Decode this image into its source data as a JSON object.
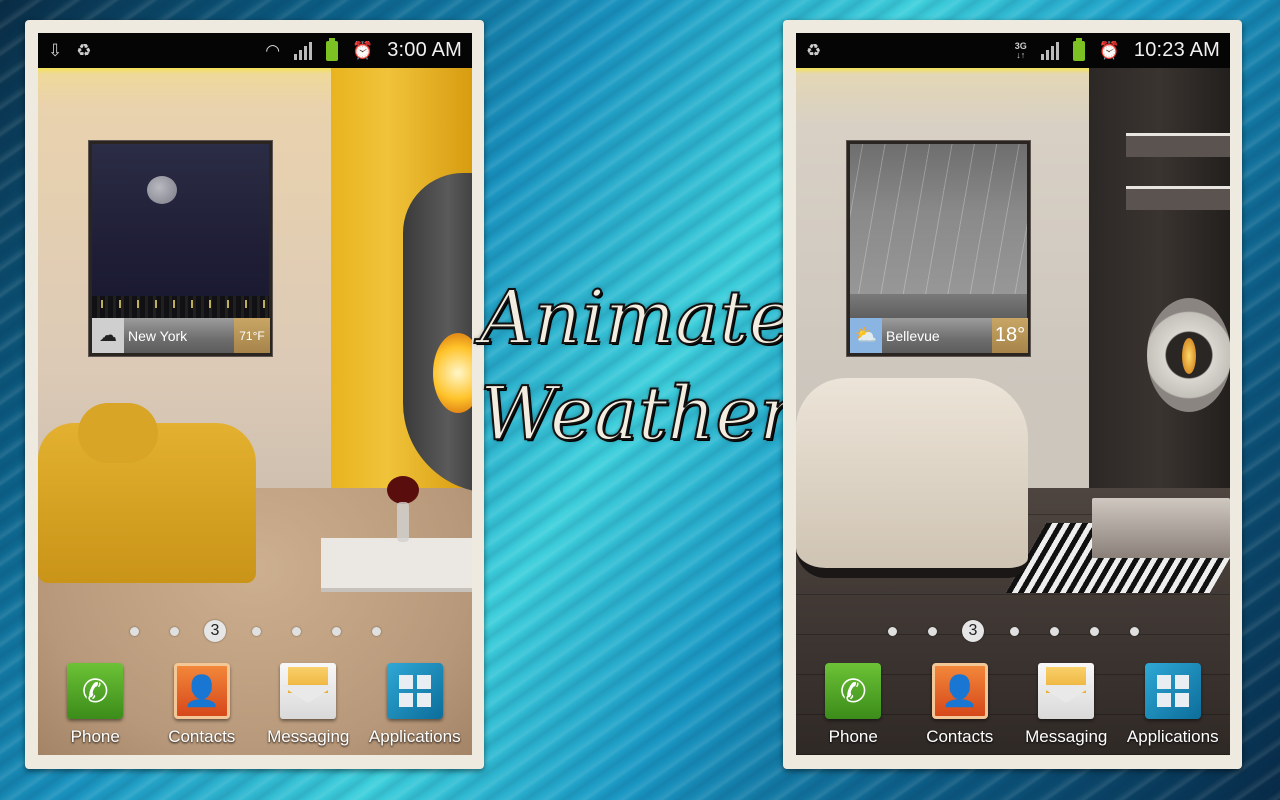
{
  "title": {
    "line1": "Animated",
    "line2": "Weather"
  },
  "screens": [
    {
      "status": {
        "left_icons": [
          "download-icon",
          "recycle-icon"
        ],
        "right_icons": [
          "wifi-icon",
          "signal-icon",
          "battery-icon",
          "alarm-icon"
        ],
        "time": "3:00 AM"
      },
      "widget": {
        "icon": "cloud-icon",
        "city": "New York",
        "temp": "71°F",
        "scene": "night-moon-city"
      },
      "pager": {
        "pages": 7,
        "current": "3"
      },
      "dock": [
        {
          "label": "Phone",
          "icon": "phone-icon"
        },
        {
          "label": "Contacts",
          "icon": "contacts-icon"
        },
        {
          "label": "Messaging",
          "icon": "envelope-icon"
        },
        {
          "label": "Applications",
          "icon": "grid-icon"
        }
      ]
    },
    {
      "status": {
        "left_icons": [
          "recycle-icon"
        ],
        "network": "3G",
        "right_icons": [
          "signal-icon",
          "battery-icon",
          "alarm-icon"
        ],
        "time": "10:23 AM"
      },
      "widget": {
        "icon": "sun-cloud-rain-icon",
        "city": "Bellevue",
        "temp": "18°",
        "scene": "rain-city"
      },
      "pager": {
        "pages": 7,
        "current": "3"
      },
      "dock": [
        {
          "label": "Phone",
          "icon": "phone-icon"
        },
        {
          "label": "Contacts",
          "icon": "contacts-icon"
        },
        {
          "label": "Messaging",
          "icon": "envelope-icon"
        },
        {
          "label": "Applications",
          "icon": "grid-icon"
        }
      ]
    }
  ]
}
